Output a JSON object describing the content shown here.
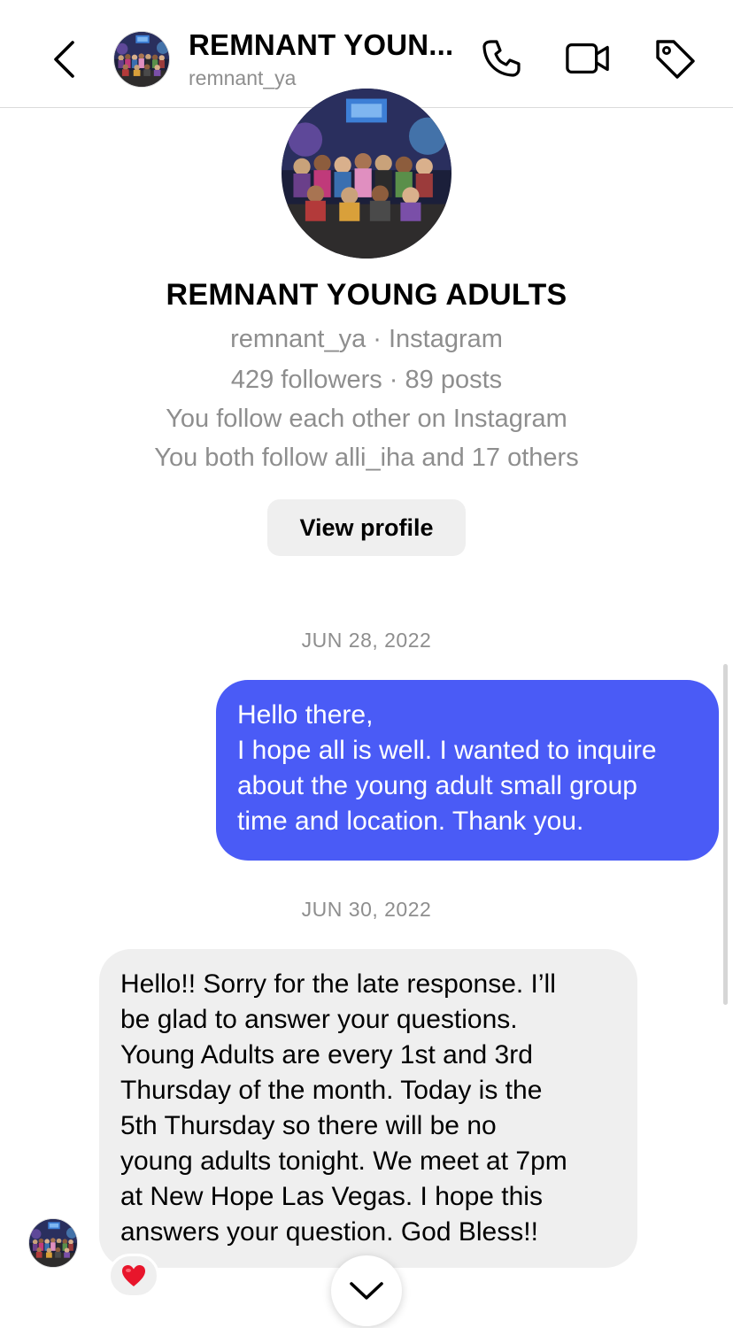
{
  "header": {
    "title": "REMNANT YOUN...",
    "username": "remnant_ya",
    "back_icon": "chevron-left-icon",
    "call_icon": "phone-icon",
    "video_icon": "video-camera-icon",
    "tag_icon": "tag-icon"
  },
  "profile": {
    "name": "REMNANT YOUNG ADULTS",
    "handle_line": "remnant_ya · Instagram",
    "stats_line": "429 followers · 89 posts",
    "mutual_line": "You follow each other on Instagram",
    "mutual_followers_line": "You both follow alli_iha and 17 others",
    "view_profile_label": "View profile"
  },
  "conversation": {
    "dates": [
      "JUN 28, 2022",
      "JUN 30, 2022"
    ],
    "outgoing_message": {
      "lines": [
        "Hello there,",
        "I hope all is well. I wanted to inquire",
        "about the young adult small group",
        "time and location. Thank you."
      ]
    },
    "incoming_message": {
      "lines": [
        "Hello!! Sorry for the late response. I’ll",
        "be glad to answer your questions.",
        "Young Adults are every 1st and 3rd",
        "Thursday of the month. Today is the",
        "5th Thursday so there will be no",
        "young adults tonight. We meet at 7pm",
        "at New Hope Las Vegas. I hope this",
        "answers your question. God Bless!!"
      ],
      "reaction": "❤️"
    },
    "scroll_down_icon": "chevron-down-icon"
  },
  "colors": {
    "outgoing_bubble": "#4a5bf6",
    "incoming_bubble": "#efefef",
    "secondary_text": "#8e8e8e"
  }
}
